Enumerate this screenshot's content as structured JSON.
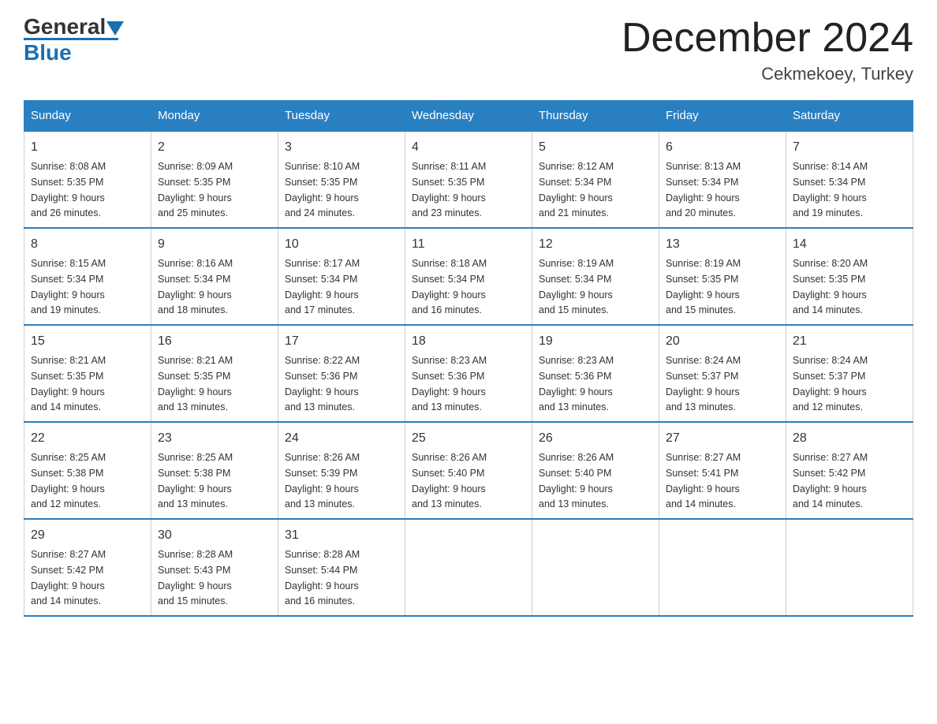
{
  "header": {
    "logo_general": "General",
    "logo_blue": "Blue",
    "month_title": "December 2024",
    "location": "Cekmekoey, Turkey"
  },
  "days_of_week": [
    "Sunday",
    "Monday",
    "Tuesday",
    "Wednesday",
    "Thursday",
    "Friday",
    "Saturday"
  ],
  "weeks": [
    [
      {
        "day": "1",
        "sunrise": "8:08 AM",
        "sunset": "5:35 PM",
        "daylight": "9 hours and 26 minutes."
      },
      {
        "day": "2",
        "sunrise": "8:09 AM",
        "sunset": "5:35 PM",
        "daylight": "9 hours and 25 minutes."
      },
      {
        "day": "3",
        "sunrise": "8:10 AM",
        "sunset": "5:35 PM",
        "daylight": "9 hours and 24 minutes."
      },
      {
        "day": "4",
        "sunrise": "8:11 AM",
        "sunset": "5:35 PM",
        "daylight": "9 hours and 23 minutes."
      },
      {
        "day": "5",
        "sunrise": "8:12 AM",
        "sunset": "5:34 PM",
        "daylight": "9 hours and 21 minutes."
      },
      {
        "day": "6",
        "sunrise": "8:13 AM",
        "sunset": "5:34 PM",
        "daylight": "9 hours and 20 minutes."
      },
      {
        "day": "7",
        "sunrise": "8:14 AM",
        "sunset": "5:34 PM",
        "daylight": "9 hours and 19 minutes."
      }
    ],
    [
      {
        "day": "8",
        "sunrise": "8:15 AM",
        "sunset": "5:34 PM",
        "daylight": "9 hours and 19 minutes."
      },
      {
        "day": "9",
        "sunrise": "8:16 AM",
        "sunset": "5:34 PM",
        "daylight": "9 hours and 18 minutes."
      },
      {
        "day": "10",
        "sunrise": "8:17 AM",
        "sunset": "5:34 PM",
        "daylight": "9 hours and 17 minutes."
      },
      {
        "day": "11",
        "sunrise": "8:18 AM",
        "sunset": "5:34 PM",
        "daylight": "9 hours and 16 minutes."
      },
      {
        "day": "12",
        "sunrise": "8:19 AM",
        "sunset": "5:34 PM",
        "daylight": "9 hours and 15 minutes."
      },
      {
        "day": "13",
        "sunrise": "8:19 AM",
        "sunset": "5:35 PM",
        "daylight": "9 hours and 15 minutes."
      },
      {
        "day": "14",
        "sunrise": "8:20 AM",
        "sunset": "5:35 PM",
        "daylight": "9 hours and 14 minutes."
      }
    ],
    [
      {
        "day": "15",
        "sunrise": "8:21 AM",
        "sunset": "5:35 PM",
        "daylight": "9 hours and 14 minutes."
      },
      {
        "day": "16",
        "sunrise": "8:21 AM",
        "sunset": "5:35 PM",
        "daylight": "9 hours and 13 minutes."
      },
      {
        "day": "17",
        "sunrise": "8:22 AM",
        "sunset": "5:36 PM",
        "daylight": "9 hours and 13 minutes."
      },
      {
        "day": "18",
        "sunrise": "8:23 AM",
        "sunset": "5:36 PM",
        "daylight": "9 hours and 13 minutes."
      },
      {
        "day": "19",
        "sunrise": "8:23 AM",
        "sunset": "5:36 PM",
        "daylight": "9 hours and 13 minutes."
      },
      {
        "day": "20",
        "sunrise": "8:24 AM",
        "sunset": "5:37 PM",
        "daylight": "9 hours and 13 minutes."
      },
      {
        "day": "21",
        "sunrise": "8:24 AM",
        "sunset": "5:37 PM",
        "daylight": "9 hours and 12 minutes."
      }
    ],
    [
      {
        "day": "22",
        "sunrise": "8:25 AM",
        "sunset": "5:38 PM",
        "daylight": "9 hours and 12 minutes."
      },
      {
        "day": "23",
        "sunrise": "8:25 AM",
        "sunset": "5:38 PM",
        "daylight": "9 hours and 13 minutes."
      },
      {
        "day": "24",
        "sunrise": "8:26 AM",
        "sunset": "5:39 PM",
        "daylight": "9 hours and 13 minutes."
      },
      {
        "day": "25",
        "sunrise": "8:26 AM",
        "sunset": "5:40 PM",
        "daylight": "9 hours and 13 minutes."
      },
      {
        "day": "26",
        "sunrise": "8:26 AM",
        "sunset": "5:40 PM",
        "daylight": "9 hours and 13 minutes."
      },
      {
        "day": "27",
        "sunrise": "8:27 AM",
        "sunset": "5:41 PM",
        "daylight": "9 hours and 14 minutes."
      },
      {
        "day": "28",
        "sunrise": "8:27 AM",
        "sunset": "5:42 PM",
        "daylight": "9 hours and 14 minutes."
      }
    ],
    [
      {
        "day": "29",
        "sunrise": "8:27 AM",
        "sunset": "5:42 PM",
        "daylight": "9 hours and 14 minutes."
      },
      {
        "day": "30",
        "sunrise": "8:28 AM",
        "sunset": "5:43 PM",
        "daylight": "9 hours and 15 minutes."
      },
      {
        "day": "31",
        "sunrise": "8:28 AM",
        "sunset": "5:44 PM",
        "daylight": "9 hours and 16 minutes."
      },
      {
        "day": "",
        "sunrise": "",
        "sunset": "",
        "daylight": ""
      },
      {
        "day": "",
        "sunrise": "",
        "sunset": "",
        "daylight": ""
      },
      {
        "day": "",
        "sunrise": "",
        "sunset": "",
        "daylight": ""
      },
      {
        "day": "",
        "sunrise": "",
        "sunset": "",
        "daylight": ""
      }
    ]
  ],
  "labels": {
    "sunrise": "Sunrise:",
    "sunset": "Sunset:",
    "daylight": "Daylight:"
  }
}
